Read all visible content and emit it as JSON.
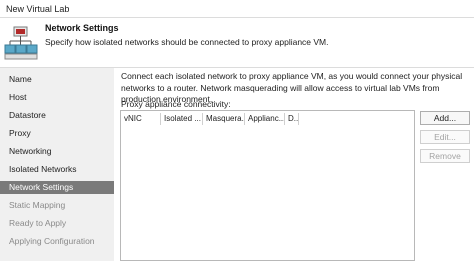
{
  "window": {
    "title": "New Virtual Lab"
  },
  "header": {
    "title": "Network Settings",
    "subtitle": "Specify how isolated networks should be connected to proxy appliance VM."
  },
  "steps": [
    {
      "label": "Name",
      "state": "normal"
    },
    {
      "label": "Host",
      "state": "normal"
    },
    {
      "label": "Datastore",
      "state": "normal"
    },
    {
      "label": "Proxy",
      "state": "normal"
    },
    {
      "label": "Networking",
      "state": "normal"
    },
    {
      "label": "Isolated Networks",
      "state": "normal"
    },
    {
      "label": "Network Settings",
      "state": "active"
    },
    {
      "label": "Static Mapping",
      "state": "disabled"
    },
    {
      "label": "Ready to Apply",
      "state": "disabled"
    },
    {
      "label": "Applying Configuration",
      "state": "disabled"
    }
  ],
  "main": {
    "description": "Connect each isolated network to proxy appliance VM, as you would connect your physical networks to a router. Network masquerading will allow access to virtual lab VMs from production environment.",
    "connectivity_label": "Proxy appliance connectivity:",
    "columns": [
      "vNIC",
      "Isolated ...",
      "Masquera...",
      "Applianc...",
      "D..."
    ],
    "rows": []
  },
  "buttons": {
    "add": "Add...",
    "edit": "Edit...",
    "remove": "Remove"
  }
}
